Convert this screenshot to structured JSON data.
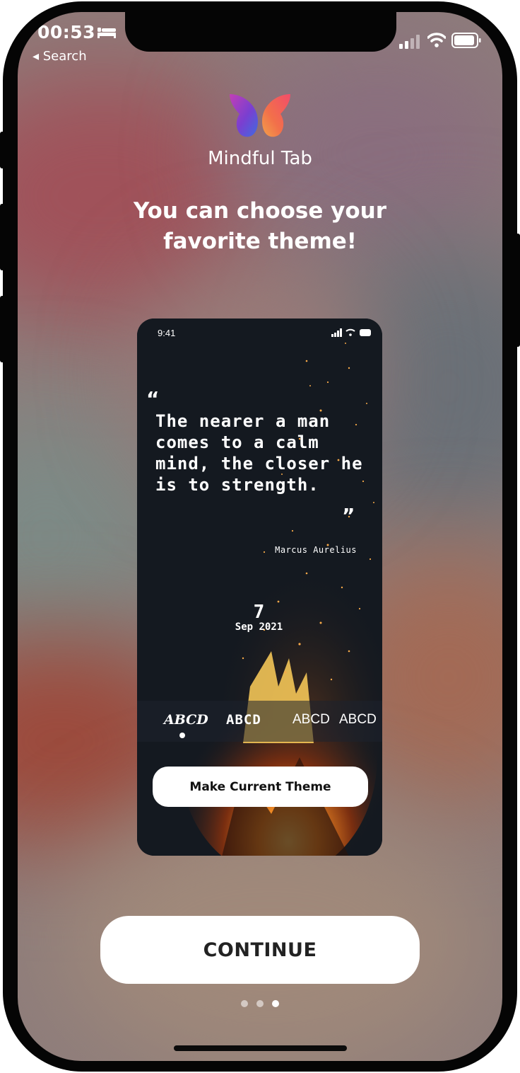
{
  "status_bar": {
    "time": "00:53",
    "back_label": "◂ Search"
  },
  "app": {
    "name": "Mindful Tab"
  },
  "onboarding": {
    "headline": "You can choose your favorite theme!"
  },
  "preview": {
    "time": "9:41",
    "quote_open": "“",
    "quote_text": "The nearer a man comes to a calm mind, the closer he is to strength.",
    "quote_close": "”",
    "author": "Marcus Aurelius",
    "date_day": "7",
    "date_rest": "Sep 2021",
    "font_options": [
      "ABCD",
      "ABCD",
      "ABCD",
      "ABCD"
    ],
    "make_theme_label": "Make Current Theme"
  },
  "cta": {
    "continue_label": "CONTINUE"
  },
  "pagination": {
    "pages": 3,
    "active_page": 3
  },
  "colors": {
    "cta_background": "#ffffff",
    "cta_text": "#222222",
    "preview_background": "#141920"
  },
  "icons": [
    "bed-icon",
    "signal-icon",
    "wifi-icon",
    "battery-icon",
    "butterfly-logo-icon"
  ]
}
